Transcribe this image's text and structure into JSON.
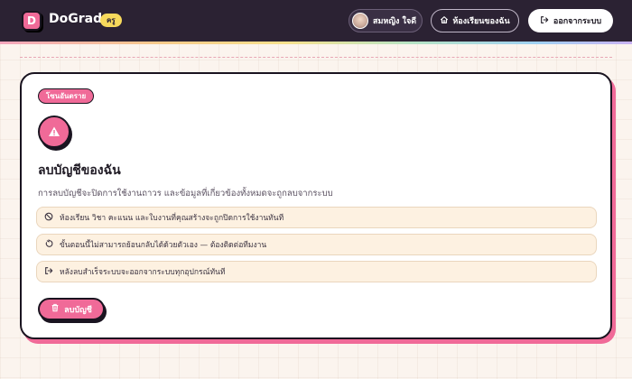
{
  "header": {
    "logo_letter": "D",
    "brand": "DoGrade",
    "role_badge": "ครู",
    "user_name": "สมหญิง ใจดี",
    "my_classes_label": "ห้องเรียนของฉัน",
    "logout_label": "ออกจากระบบ",
    "icons": [
      "home-icon",
      "logout-icon"
    ]
  },
  "card": {
    "danger_tag": "โซนอันตราย",
    "title": "ลบบัญชีของฉัน",
    "description": "การลบบัญชีจะปิดการใช้งานถาวร และข้อมูลที่เกี่ยวข้องทั้งหมดจะถูกลบจากระบบ",
    "items": [
      {
        "icon": "prohibited-icon",
        "text": "ห้องเรียน วิชา คะแนน และใบงานที่คุณสร้างจะถูกปิดการใช้งานทันที"
      },
      {
        "icon": "undo-icon",
        "text": "ขั้นตอนนี้ไม่สามารถย้อนกลับได้ด้วยตัวเอง — ต้องติดต่อทีมงาน"
      },
      {
        "icon": "logout-icon",
        "text": "หลังลบสำเร็จระบบจะออกจากระบบทุกอุปกรณ์ทันที"
      }
    ],
    "delete_button": "ลบบัญชี",
    "delete_icon": "trash-icon",
    "warning_icon": "warning-icon"
  },
  "colors": {
    "accent": "#f06a98",
    "topbar": "#2b2233",
    "badge": "#f7d95c",
    "info_bg": "#fdf1e1"
  }
}
